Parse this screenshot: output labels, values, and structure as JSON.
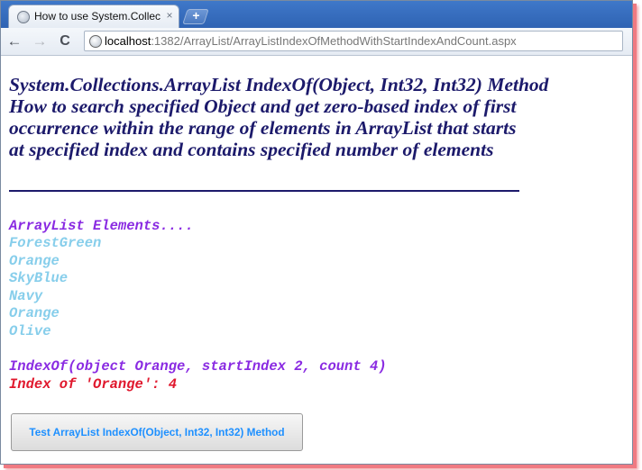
{
  "browser": {
    "tab_title": "How to use System.Collecti",
    "tab_close": "×",
    "new_tab": "+",
    "back": "←",
    "forward": "→",
    "reload": "C",
    "url_host": "localhost",
    "url_path": ":1382/ArrayList/ArrayListIndexOfMethodWithStartIndexAndCount.aspx"
  },
  "page": {
    "heading_lines": [
      "System.Collections.ArrayList IndexOf(Object, Int32, Int32) Method",
      "How to search specified Object and get zero-based index of first",
      "occurrence within the range of elements in ArrayList that starts",
      "at specified index and contains specified number of elements"
    ],
    "list_title": "ArrayList Elements....",
    "elements": [
      "ForestGreen",
      "Orange",
      "SkyBlue",
      "Navy",
      "Orange",
      "Olive"
    ],
    "query": "IndexOf(object Orange, startIndex 2, count 4)",
    "result": "Index of 'Orange': 4",
    "button_label": "Test ArrayList IndexOf(Object, Int32, Int32) Method"
  },
  "colors": {
    "heading": "#1c1a6b",
    "list_title": "#8a2be2",
    "elements": "#87ceeb",
    "result": "#e0182d",
    "button_text": "#1e90ff"
  }
}
